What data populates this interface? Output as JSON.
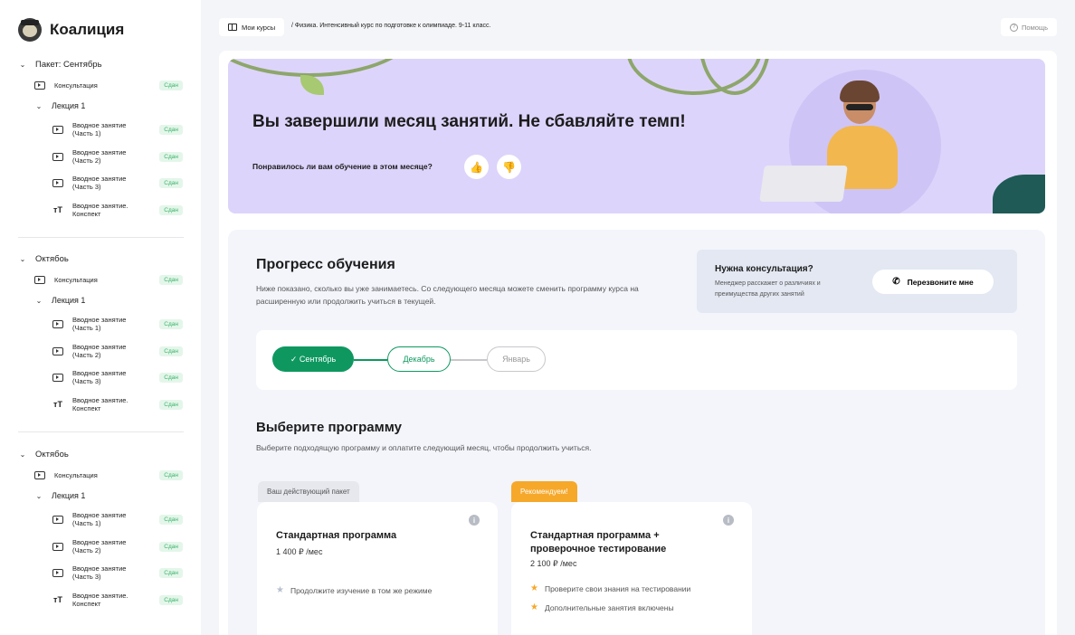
{
  "app": {
    "name": "Коалиция"
  },
  "sidebar": {
    "sections": [
      {
        "title": "Пакет: Сентябрь",
        "consultation": "Консультация",
        "lecture": "Лекция 1",
        "items": [
          {
            "label1": "Вводное занятие",
            "label2": "(Часть 1)",
            "icon": "video-icon"
          },
          {
            "label1": "Вводное занятие",
            "label2": "(Часть 2)",
            "icon": "video-icon"
          },
          {
            "label1": "Вводное занятие",
            "label2": "(Часть 3)",
            "icon": "video-icon"
          },
          {
            "label1": "Вводное занятие.",
            "label2": "Конспект",
            "icon": "text-icon"
          }
        ],
        "badge": "Сдан"
      },
      {
        "title": "Октябоь",
        "consultation": "Консультация",
        "lecture": "Лекция 1",
        "items": [
          {
            "label1": "Вводное занятие",
            "label2": "(Часть 1)",
            "icon": "video-icon"
          },
          {
            "label1": "Вводное занятие",
            "label2": "(Часть 2)",
            "icon": "video-icon"
          },
          {
            "label1": "Вводное занятие",
            "label2": "(Часть 3)",
            "icon": "video-icon"
          },
          {
            "label1": "Вводное занятие.",
            "label2": "Конспект",
            "icon": "text-icon"
          }
        ],
        "badge": "Сдан"
      },
      {
        "title": "Октябоь",
        "consultation": "Консультация",
        "lecture": "Лекция 1",
        "items": [
          {
            "label1": "Вводное занятие",
            "label2": "(Часть 1)",
            "icon": "video-icon"
          },
          {
            "label1": "Вводное занятие",
            "label2": "(Часть 2)",
            "icon": "video-icon"
          },
          {
            "label1": "Вводное занятие",
            "label2": "(Часть 3)",
            "icon": "video-icon"
          },
          {
            "label1": "Вводное занятие.",
            "label2": "Конспект",
            "icon": "text-icon"
          }
        ],
        "badge": "Сдан"
      }
    ]
  },
  "topbar": {
    "my_courses": "Мои курсы",
    "path": "/  Физика. Интенсивный курс по подготовке к олимпиаде. 9-11 класс.",
    "help": "Помощь"
  },
  "hero": {
    "title": "Вы завершили месяц занятий. Не сбавляйте темп!",
    "question": "Понравилось ли вам обучение в этом месяце?",
    "like": "👍",
    "dislike": "👎"
  },
  "progress": {
    "title": "Прогресс обучения",
    "description": "Ниже показано, сколько вы уже занимаетесь. Со следующего месяца можете сменить программу курса на расширенную или продолжить учиться в текущей.",
    "consult_title": "Нужна консультация?",
    "consult_desc": "Менеджер расскажет о различиях и преимущества других занятий",
    "call_button": "Перезвоните мне",
    "steps": [
      "✓ Сентябрь",
      "Декабрь",
      "Январь"
    ]
  },
  "programs": {
    "title": "Выберите программу",
    "description": "Выберите подходящую программу и оплатите следующий месяц, чтобы продолжить учиться.",
    "current_tag": "Ваш действующий пакет",
    "recommended_tag": "Рекомендуем!",
    "plans": [
      {
        "name": "Стандартная программа",
        "price": "1 400 ₽ /мес",
        "features": [
          "Продолжите изучение в том же режиме"
        ]
      },
      {
        "name": "Стандартная программа + проверочное тестирование",
        "price": "2 100 ₽ /мес",
        "features": [
          "Проверите свои знания на тестировании",
          "Дополнительные занятия включены"
        ]
      }
    ]
  },
  "colors": {
    "accent": "#0e9860",
    "hero_bg": "#ddd4fb",
    "badge_text": "#3bb36a",
    "recommended": "#f6a82a"
  }
}
